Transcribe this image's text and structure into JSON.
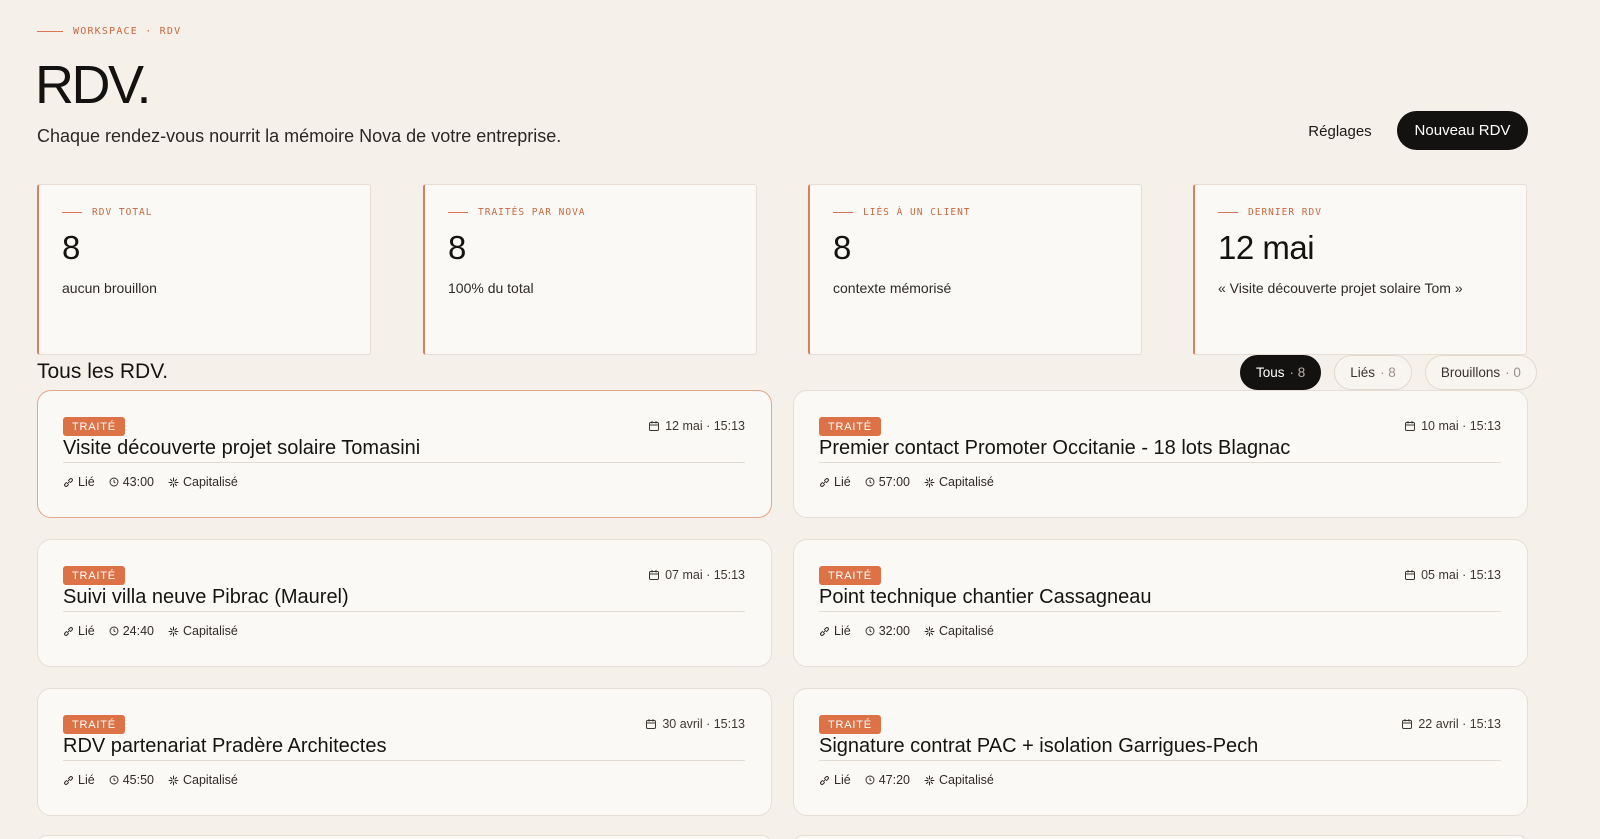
{
  "header": {
    "eyebrow": "WORKSPACE · RDV",
    "title": "RDV.",
    "subtitle": "Chaque rendez-vous nourrit la mémoire Nova de votre entreprise.",
    "settings_label": "Réglages",
    "new_label": "Nouveau RDV"
  },
  "stats": [
    {
      "label": "RDV TOTAL",
      "value": "8",
      "note": "aucun brouillon"
    },
    {
      "label": "TRAITÉS PAR NOVA",
      "value": "8",
      "note": "100% du total"
    },
    {
      "label": "LIÉS À UN CLIENT",
      "value": "8",
      "note": "contexte mémorisé"
    },
    {
      "label": "DERNIER RDV",
      "value": "12 mai",
      "note": "« Visite découverte projet solaire Tom »"
    }
  ],
  "list": {
    "title": "Tous les RDV.",
    "filters": [
      {
        "label": "Tous",
        "count": "· 8",
        "active": true
      },
      {
        "label": "Liés",
        "count": "· 8",
        "active": false
      },
      {
        "label": "Brouillons",
        "count": "· 0",
        "active": false
      }
    ]
  },
  "meetings": [
    {
      "badge": "TRAITÉ",
      "date": "12 mai · 15:13",
      "title": "Visite découverte projet solaire Tomasini",
      "link": "Lié",
      "duration": "43:00",
      "status": "Capitalisé"
    },
    {
      "badge": "TRAITÉ",
      "date": "10 mai · 15:13",
      "title": "Premier contact Promoter Occitanie - 18 lots Blagnac",
      "link": "Lié",
      "duration": "57:00",
      "status": "Capitalisé"
    },
    {
      "badge": "TRAITÉ",
      "date": "07 mai · 15:13",
      "title": "Suivi villa neuve Pibrac (Maurel)",
      "link": "Lié",
      "duration": "24:40",
      "status": "Capitalisé"
    },
    {
      "badge": "TRAITÉ",
      "date": "05 mai · 15:13",
      "title": "Point technique chantier Cassagneau",
      "link": "Lié",
      "duration": "32:00",
      "status": "Capitalisé"
    },
    {
      "badge": "TRAITÉ",
      "date": "30 avril · 15:13",
      "title": "RDV partenariat Pradère Architectes",
      "link": "Lié",
      "duration": "45:50",
      "status": "Capitalisé"
    },
    {
      "badge": "TRAITÉ",
      "date": "22 avril · 15:13",
      "title": "Signature contrat PAC + isolation Garrigues-Pech",
      "link": "Lié",
      "duration": "47:20",
      "status": "Capitalisé"
    }
  ],
  "icons": {
    "calendar": "calendar-icon",
    "link": "link-icon",
    "duration": "clock-icon",
    "status": "sparkle-icon"
  },
  "colors": {
    "accent": "#dd7247",
    "background": "#f5f0ea",
    "dark": "#141210"
  }
}
